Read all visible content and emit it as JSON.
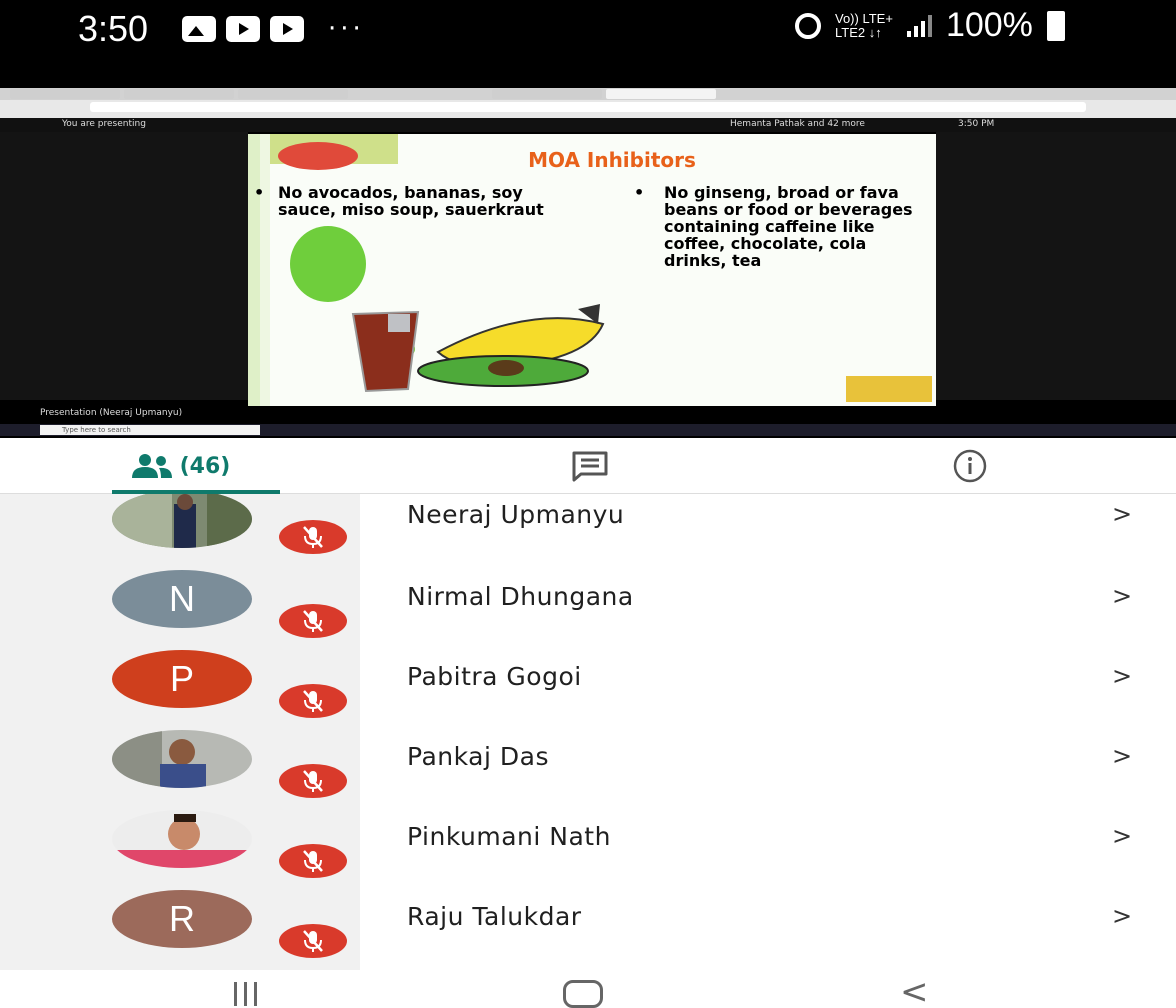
{
  "status_bar": {
    "time": "3:50",
    "network": "Vo)) LTE+\nLTE2 ↓↑",
    "battery": "100%"
  },
  "meeting": {
    "presenting_label": "You are presenting",
    "others_label": "Hemanta Pathak and 42 more",
    "clock": "3:50 PM",
    "presentation_caption": "Presentation (Neeraj Upmanyu)",
    "taskbar_search": "Type here to search"
  },
  "slide": {
    "title": "MOA Inhibitors",
    "left_bullet": "No avocados, bananas, soy sauce, miso soup, sauerkraut",
    "right_bullet": "No ginseng, broad or fava beans or food or beverages containing caffeine like coffee, chocolate, cola drinks, tea"
  },
  "tabs": {
    "people_count": "(46)",
    "accent_color": "#0f7a6c"
  },
  "participants": [
    {
      "name": "Neeraj Upmanyu",
      "initial": "",
      "avatar_type": "photo",
      "avatar_color": "#8a8f7a"
    },
    {
      "name": "Nirmal Dhungana",
      "initial": "N",
      "avatar_type": "letter",
      "avatar_color": "#7b8d99"
    },
    {
      "name": "Pabitra Gogoi",
      "initial": "P",
      "avatar_type": "letter",
      "avatar_color": "#cf3f1d"
    },
    {
      "name": "Pankaj Das",
      "initial": "",
      "avatar_type": "photo",
      "avatar_color": "#7f8a86"
    },
    {
      "name": "Pinkumani Nath",
      "initial": "",
      "avatar_type": "photo",
      "avatar_color": "#c9867a"
    },
    {
      "name": "Raju Talukdar",
      "initial": "R",
      "avatar_type": "letter",
      "avatar_color": "#9c6a5b"
    }
  ],
  "chevron": ">",
  "nav": {
    "back": "<"
  }
}
